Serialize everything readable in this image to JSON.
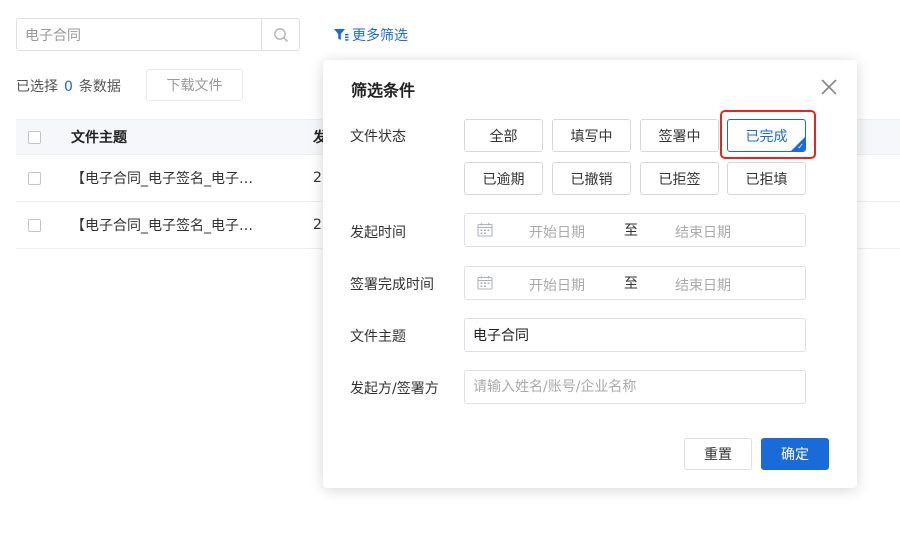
{
  "search": {
    "value": "电子合同"
  },
  "toolbar": {
    "more_filter_label": "更多筛选"
  },
  "selection": {
    "prefix": "已选择",
    "count": "0",
    "suffix": "条数据",
    "download_label": "下载文件"
  },
  "table": {
    "headers": [
      "文件主题",
      "发"
    ],
    "rows": [
      {
        "subject": "【电子合同_电子签名_电子…",
        "next": "2"
      },
      {
        "subject": "【电子合同_电子签名_电子…",
        "next": "2"
      }
    ]
  },
  "dialog": {
    "title": "筛选条件",
    "fields": {
      "status_label": "文件状态",
      "start_time_label": "发起时间",
      "complete_time_label": "签署完成时间",
      "subject_label": "文件主题",
      "party_label": "发起方/签署方"
    },
    "status_options": [
      "全部",
      "填写中",
      "签署中",
      "已完成",
      "已逾期",
      "已撤销",
      "已拒签",
      "已拒填"
    ],
    "selected_status": "已完成",
    "date_range": {
      "start_placeholder": "开始日期",
      "separator": "至",
      "end_placeholder": "结束日期"
    },
    "subject_value": "电子合同",
    "party_placeholder": "请输入姓名/账号/企业名称",
    "reset_label": "重置",
    "confirm_label": "确定"
  },
  "colors": {
    "accent": "#1a6bd8",
    "highlight": "#e5261f"
  }
}
